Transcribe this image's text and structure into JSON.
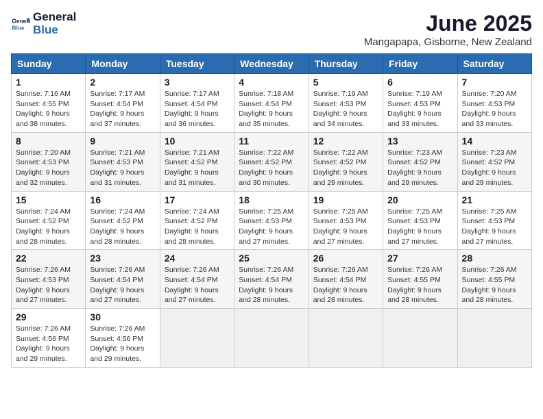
{
  "logo": {
    "general": "General",
    "blue": "Blue"
  },
  "title": "June 2025",
  "subtitle": "Mangapapa, Gisborne, New Zealand",
  "headers": [
    "Sunday",
    "Monday",
    "Tuesday",
    "Wednesday",
    "Thursday",
    "Friday",
    "Saturday"
  ],
  "weeks": [
    [
      {
        "day": "1",
        "sunrise": "Sunrise: 7:16 AM",
        "sunset": "Sunset: 4:55 PM",
        "daylight": "Daylight: 9 hours and 38 minutes."
      },
      {
        "day": "2",
        "sunrise": "Sunrise: 7:17 AM",
        "sunset": "Sunset: 4:54 PM",
        "daylight": "Daylight: 9 hours and 37 minutes."
      },
      {
        "day": "3",
        "sunrise": "Sunrise: 7:17 AM",
        "sunset": "Sunset: 4:54 PM",
        "daylight": "Daylight: 9 hours and 36 minutes."
      },
      {
        "day": "4",
        "sunrise": "Sunrise: 7:18 AM",
        "sunset": "Sunset: 4:54 PM",
        "daylight": "Daylight: 9 hours and 35 minutes."
      },
      {
        "day": "5",
        "sunrise": "Sunrise: 7:19 AM",
        "sunset": "Sunset: 4:53 PM",
        "daylight": "Daylight: 9 hours and 34 minutes."
      },
      {
        "day": "6",
        "sunrise": "Sunrise: 7:19 AM",
        "sunset": "Sunset: 4:53 PM",
        "daylight": "Daylight: 9 hours and 33 minutes."
      },
      {
        "day": "7",
        "sunrise": "Sunrise: 7:20 AM",
        "sunset": "Sunset: 4:53 PM",
        "daylight": "Daylight: 9 hours and 33 minutes."
      }
    ],
    [
      {
        "day": "8",
        "sunrise": "Sunrise: 7:20 AM",
        "sunset": "Sunset: 4:53 PM",
        "daylight": "Daylight: 9 hours and 32 minutes."
      },
      {
        "day": "9",
        "sunrise": "Sunrise: 7:21 AM",
        "sunset": "Sunset: 4:53 PM",
        "daylight": "Daylight: 9 hours and 31 minutes."
      },
      {
        "day": "10",
        "sunrise": "Sunrise: 7:21 AM",
        "sunset": "Sunset: 4:52 PM",
        "daylight": "Daylight: 9 hours and 31 minutes."
      },
      {
        "day": "11",
        "sunrise": "Sunrise: 7:22 AM",
        "sunset": "Sunset: 4:52 PM",
        "daylight": "Daylight: 9 hours and 30 minutes."
      },
      {
        "day": "12",
        "sunrise": "Sunrise: 7:22 AM",
        "sunset": "Sunset: 4:52 PM",
        "daylight": "Daylight: 9 hours and 29 minutes."
      },
      {
        "day": "13",
        "sunrise": "Sunrise: 7:23 AM",
        "sunset": "Sunset: 4:52 PM",
        "daylight": "Daylight: 9 hours and 29 minutes."
      },
      {
        "day": "14",
        "sunrise": "Sunrise: 7:23 AM",
        "sunset": "Sunset: 4:52 PM",
        "daylight": "Daylight: 9 hours and 29 minutes."
      }
    ],
    [
      {
        "day": "15",
        "sunrise": "Sunrise: 7:24 AM",
        "sunset": "Sunset: 4:52 PM",
        "daylight": "Daylight: 9 hours and 28 minutes."
      },
      {
        "day": "16",
        "sunrise": "Sunrise: 7:24 AM",
        "sunset": "Sunset: 4:52 PM",
        "daylight": "Daylight: 9 hours and 28 minutes."
      },
      {
        "day": "17",
        "sunrise": "Sunrise: 7:24 AM",
        "sunset": "Sunset: 4:52 PM",
        "daylight": "Daylight: 9 hours and 28 minutes."
      },
      {
        "day": "18",
        "sunrise": "Sunrise: 7:25 AM",
        "sunset": "Sunset: 4:53 PM",
        "daylight": "Daylight: 9 hours and 27 minutes."
      },
      {
        "day": "19",
        "sunrise": "Sunrise: 7:25 AM",
        "sunset": "Sunset: 4:53 PM",
        "daylight": "Daylight: 9 hours and 27 minutes."
      },
      {
        "day": "20",
        "sunrise": "Sunrise: 7:25 AM",
        "sunset": "Sunset: 4:53 PM",
        "daylight": "Daylight: 9 hours and 27 minutes."
      },
      {
        "day": "21",
        "sunrise": "Sunrise: 7:25 AM",
        "sunset": "Sunset: 4:53 PM",
        "daylight": "Daylight: 9 hours and 27 minutes."
      }
    ],
    [
      {
        "day": "22",
        "sunrise": "Sunrise: 7:26 AM",
        "sunset": "Sunset: 4:53 PM",
        "daylight": "Daylight: 9 hours and 27 minutes."
      },
      {
        "day": "23",
        "sunrise": "Sunrise: 7:26 AM",
        "sunset": "Sunset: 4:54 PM",
        "daylight": "Daylight: 9 hours and 27 minutes."
      },
      {
        "day": "24",
        "sunrise": "Sunrise: 7:26 AM",
        "sunset": "Sunset: 4:54 PM",
        "daylight": "Daylight: 9 hours and 27 minutes."
      },
      {
        "day": "25",
        "sunrise": "Sunrise: 7:26 AM",
        "sunset": "Sunset: 4:54 PM",
        "daylight": "Daylight: 9 hours and 28 minutes."
      },
      {
        "day": "26",
        "sunrise": "Sunrise: 7:26 AM",
        "sunset": "Sunset: 4:54 PM",
        "daylight": "Daylight: 9 hours and 28 minutes."
      },
      {
        "day": "27",
        "sunrise": "Sunrise: 7:26 AM",
        "sunset": "Sunset: 4:55 PM",
        "daylight": "Daylight: 9 hours and 28 minutes."
      },
      {
        "day": "28",
        "sunrise": "Sunrise: 7:26 AM",
        "sunset": "Sunset: 4:55 PM",
        "daylight": "Daylight: 9 hours and 28 minutes."
      }
    ],
    [
      {
        "day": "29",
        "sunrise": "Sunrise: 7:26 AM",
        "sunset": "Sunset: 4:56 PM",
        "daylight": "Daylight: 9 hours and 29 minutes."
      },
      {
        "day": "30",
        "sunrise": "Sunrise: 7:26 AM",
        "sunset": "Sunset: 4:56 PM",
        "daylight": "Daylight: 9 hours and 29 minutes."
      },
      null,
      null,
      null,
      null,
      null
    ]
  ]
}
